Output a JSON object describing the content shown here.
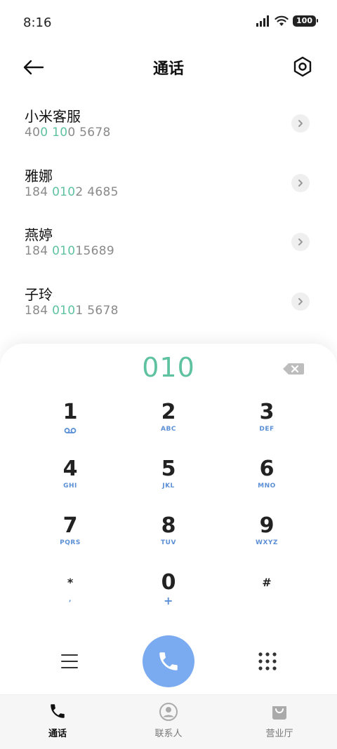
{
  "status_bar": {
    "time": "8:16",
    "battery": "100"
  },
  "header": {
    "title": "通话"
  },
  "contacts": [
    {
      "name": "小米客服",
      "number": [
        {
          "t": "40",
          "h": false
        },
        {
          "t": "0",
          "h": true
        },
        {
          "t": " ",
          "h": false
        },
        {
          "t": "10",
          "h": true
        },
        {
          "t": "0 5678",
          "h": false
        }
      ]
    },
    {
      "name": "雅娜",
      "number": [
        {
          "t": "184 ",
          "h": false
        },
        {
          "t": "010",
          "h": true
        },
        {
          "t": "2 4685",
          "h": false
        }
      ]
    },
    {
      "name": "燕婷",
      "number": [
        {
          "t": "184 ",
          "h": false
        },
        {
          "t": "010",
          "h": true
        },
        {
          "t": "15689",
          "h": false
        }
      ]
    },
    {
      "name": "子玲",
      "number": [
        {
          "t": "184 ",
          "h": false
        },
        {
          "t": "010",
          "h": true
        },
        {
          "t": "1 5678",
          "h": false
        }
      ]
    }
  ],
  "dialpad": {
    "input": "010",
    "keys": [
      {
        "digit": "1",
        "letters": "",
        "icon": "voicemail-icon"
      },
      {
        "digit": "2",
        "letters": "ABC"
      },
      {
        "digit": "3",
        "letters": "DEF"
      },
      {
        "digit": "4",
        "letters": "GHI"
      },
      {
        "digit": "5",
        "letters": "JKL"
      },
      {
        "digit": "6",
        "letters": "MNO"
      },
      {
        "digit": "7",
        "letters": "PQRS"
      },
      {
        "digit": "8",
        "letters": "TUV"
      },
      {
        "digit": "9",
        "letters": "WXYZ"
      },
      {
        "digit": "*",
        "letters": ","
      },
      {
        "digit": "0",
        "letters": "+"
      },
      {
        "digit": "#",
        "letters": ""
      }
    ]
  },
  "bottom_nav": {
    "items": [
      {
        "label": "通话",
        "icon": "phone-icon",
        "active": true
      },
      {
        "label": "联系人",
        "icon": "contact-icon",
        "active": false
      },
      {
        "label": "营业厅",
        "icon": "shopping-bag-icon",
        "active": false
      }
    ]
  },
  "colors": {
    "accent_green": "#5ec2a0",
    "call_blue": "#7aaaf0",
    "letters_blue": "#5b8fd6"
  }
}
